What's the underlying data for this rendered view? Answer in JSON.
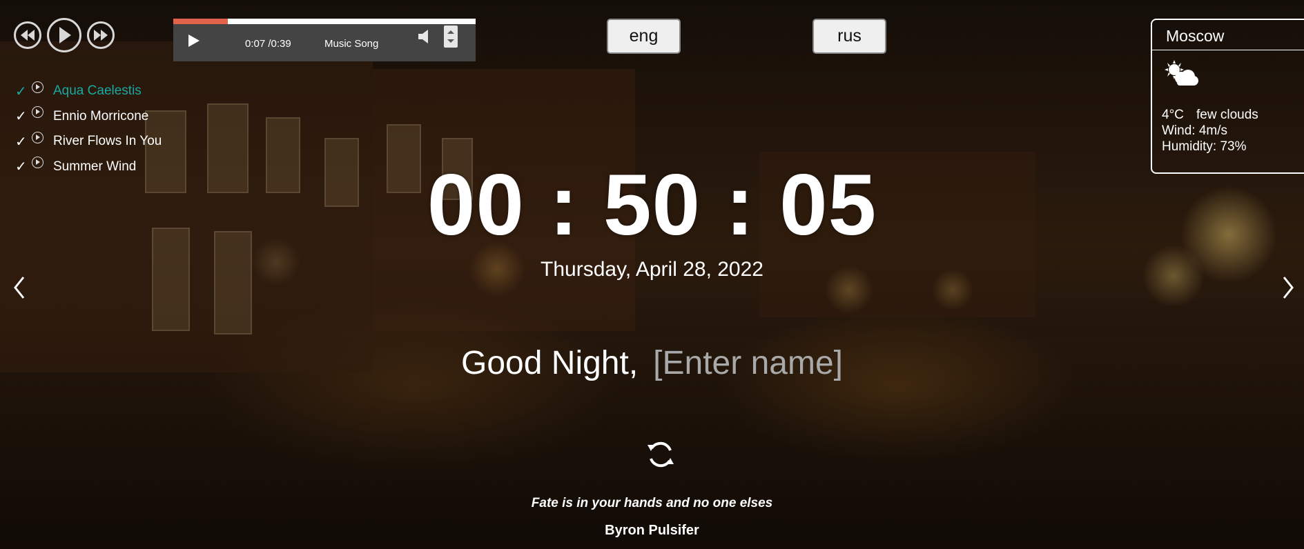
{
  "player": {
    "buttons": [
      "prev-icon",
      "play-icon",
      "next-icon"
    ],
    "current_time": "0:07",
    "duration": "0:39",
    "track_title": "Music Song",
    "progress": 0.18,
    "accent_color": "#e2624a"
  },
  "playlist": [
    {
      "title": "Aqua Caelestis",
      "active": true
    },
    {
      "title": "Ennio Morricone",
      "active": false
    },
    {
      "title": "River Flows In You",
      "active": false
    },
    {
      "title": "Summer Wind",
      "active": false
    }
  ],
  "playlist_active_color": "#1aa9a0",
  "languages": {
    "eng": "eng",
    "rus": "rus"
  },
  "weather": {
    "city": "Moscow",
    "icon": "few-clouds-icon",
    "temperature": "4°C",
    "description": "few clouds",
    "wind": "Wind: 4m/s",
    "humidity": "Humidity: 73%"
  },
  "clock": {
    "time": "00 : 50 : 05",
    "date": "Thursday, April 28, 2022"
  },
  "greeting": {
    "text": "Good Night,",
    "name_placeholder": "[Enter name]"
  },
  "quote": {
    "text": "Fate is in your hands and no one elses",
    "author": "Byron Pulsifer"
  }
}
